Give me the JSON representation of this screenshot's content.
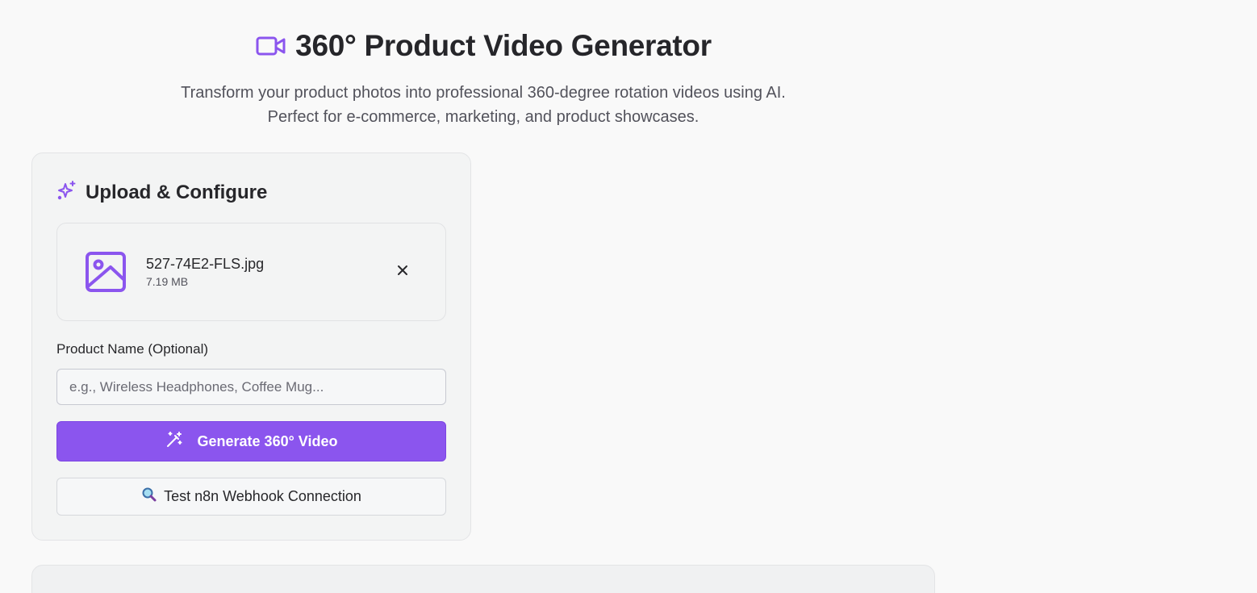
{
  "header": {
    "title": "360° Product Video Generator",
    "title_icon": "video-camera-icon",
    "subtitle_line1": "Transform your product photos into professional 360-degree rotation videos using AI.",
    "subtitle_line2": "Perfect for e-commerce, marketing, and product showcases."
  },
  "upload_card": {
    "title": "Upload & Configure",
    "title_icon": "sparkles-icon",
    "file": {
      "icon": "image-icon",
      "name": "527-74E2-FLS.jpg",
      "size": "7.19 MB",
      "remove_icon": "close-icon"
    },
    "product_name": {
      "label": "Product Name (Optional)",
      "value": "",
      "placeholder": "e.g., Wireless Headphones, Coffee Mug..."
    },
    "generate_button": {
      "label": "Generate 360° Video",
      "icon": "magic-wand-icon"
    },
    "test_button": {
      "label": "Test n8n Webhook Connection",
      "icon": "magnifying-glass-icon"
    }
  },
  "colors": {
    "accent": "#8b55ee",
    "background": "#f9f9f9",
    "card": "#f3f4f4",
    "text": "#27272a",
    "muted": "#52525b"
  }
}
